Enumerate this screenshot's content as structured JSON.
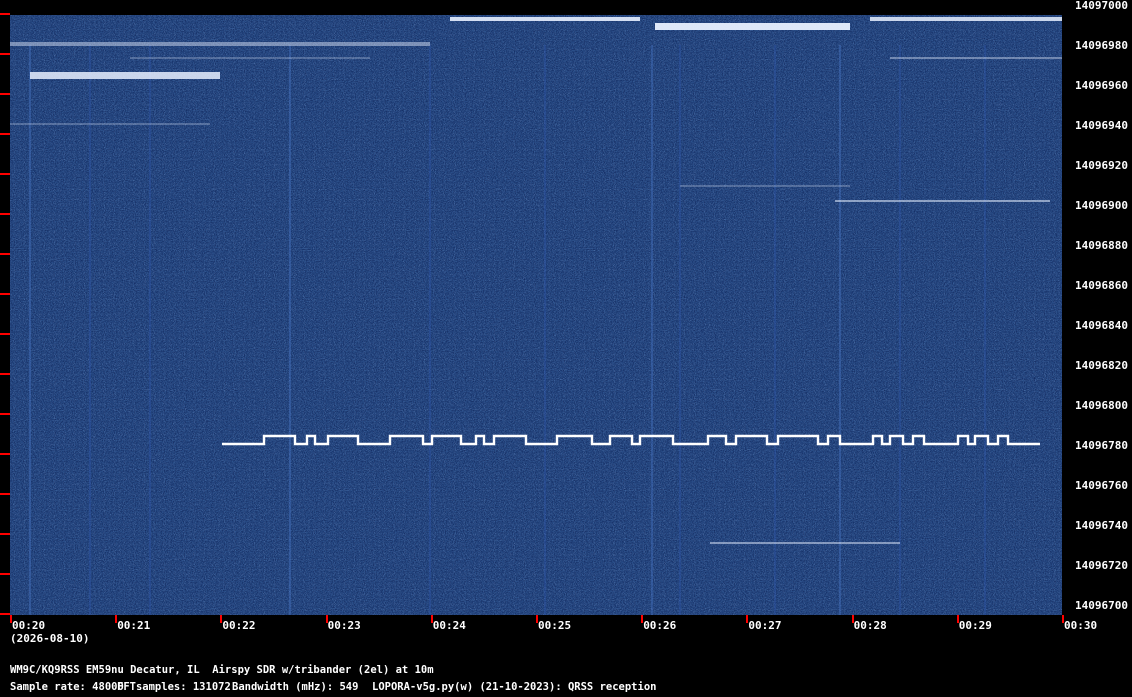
{
  "spectrogram": {
    "y_labels": [
      "14097000",
      "14096980",
      "14096960",
      "14096940",
      "14096920",
      "14096900",
      "14096880",
      "14096860",
      "14096840",
      "14096820",
      "14096800",
      "14096780",
      "14096760",
      "14096740",
      "14096720",
      "14096700"
    ],
    "x_labels": [
      "00:20",
      "00:21",
      "00:22",
      "00:23",
      "00:24",
      "00:25",
      "00:26",
      "00:27",
      "00:28",
      "00:29",
      "00:30"
    ],
    "date": "(2026-08-10)",
    "colors": {
      "background": "#0a1f55",
      "tick": "#ff0000",
      "trace": "#ffffff"
    }
  },
  "footer": {
    "station": "WM9C/KQ9RSS EM59nu Decatur, IL  Airspy SDR w/tribander (2el) at 10m",
    "sample_rate": "Sample rate: 48000",
    "fft_samples": "FFTsamples: 131072",
    "bandwidth": "Bandwidth (mHz): 549",
    "software": "LOPORA-v5g.py(w) (21-10-2023): QRSS reception"
  }
}
